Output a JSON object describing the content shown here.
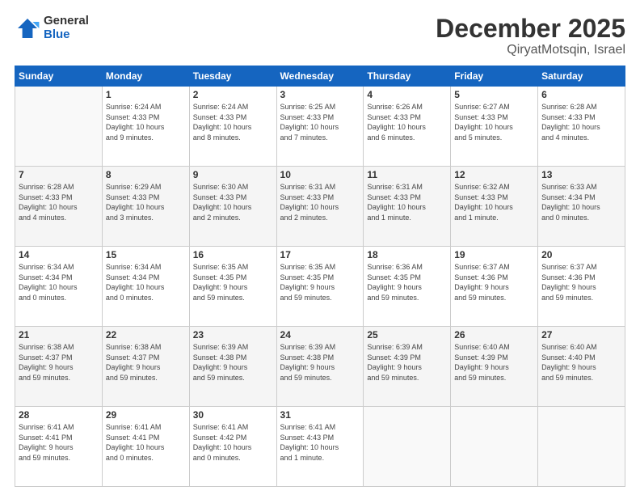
{
  "logo": {
    "general": "General",
    "blue": "Blue"
  },
  "header": {
    "month": "December 2025",
    "location": "QiryatMotsqin, Israel"
  },
  "weekdays": [
    "Sunday",
    "Monday",
    "Tuesday",
    "Wednesday",
    "Thursday",
    "Friday",
    "Saturday"
  ],
  "weeks": [
    [
      {
        "day": "",
        "info": ""
      },
      {
        "day": "1",
        "info": "Sunrise: 6:24 AM\nSunset: 4:33 PM\nDaylight: 10 hours\nand 9 minutes."
      },
      {
        "day": "2",
        "info": "Sunrise: 6:24 AM\nSunset: 4:33 PM\nDaylight: 10 hours\nand 8 minutes."
      },
      {
        "day": "3",
        "info": "Sunrise: 6:25 AM\nSunset: 4:33 PM\nDaylight: 10 hours\nand 7 minutes."
      },
      {
        "day": "4",
        "info": "Sunrise: 6:26 AM\nSunset: 4:33 PM\nDaylight: 10 hours\nand 6 minutes."
      },
      {
        "day": "5",
        "info": "Sunrise: 6:27 AM\nSunset: 4:33 PM\nDaylight: 10 hours\nand 5 minutes."
      },
      {
        "day": "6",
        "info": "Sunrise: 6:28 AM\nSunset: 4:33 PM\nDaylight: 10 hours\nand 4 minutes."
      }
    ],
    [
      {
        "day": "7",
        "info": "Sunrise: 6:28 AM\nSunset: 4:33 PM\nDaylight: 10 hours\nand 4 minutes."
      },
      {
        "day": "8",
        "info": "Sunrise: 6:29 AM\nSunset: 4:33 PM\nDaylight: 10 hours\nand 3 minutes."
      },
      {
        "day": "9",
        "info": "Sunrise: 6:30 AM\nSunset: 4:33 PM\nDaylight: 10 hours\nand 2 minutes."
      },
      {
        "day": "10",
        "info": "Sunrise: 6:31 AM\nSunset: 4:33 PM\nDaylight: 10 hours\nand 2 minutes."
      },
      {
        "day": "11",
        "info": "Sunrise: 6:31 AM\nSunset: 4:33 PM\nDaylight: 10 hours\nand 1 minute."
      },
      {
        "day": "12",
        "info": "Sunrise: 6:32 AM\nSunset: 4:33 PM\nDaylight: 10 hours\nand 1 minute."
      },
      {
        "day": "13",
        "info": "Sunrise: 6:33 AM\nSunset: 4:34 PM\nDaylight: 10 hours\nand 0 minutes."
      }
    ],
    [
      {
        "day": "14",
        "info": "Sunrise: 6:34 AM\nSunset: 4:34 PM\nDaylight: 10 hours\nand 0 minutes."
      },
      {
        "day": "15",
        "info": "Sunrise: 6:34 AM\nSunset: 4:34 PM\nDaylight: 10 hours\nand 0 minutes."
      },
      {
        "day": "16",
        "info": "Sunrise: 6:35 AM\nSunset: 4:35 PM\nDaylight: 9 hours\nand 59 minutes."
      },
      {
        "day": "17",
        "info": "Sunrise: 6:35 AM\nSunset: 4:35 PM\nDaylight: 9 hours\nand 59 minutes."
      },
      {
        "day": "18",
        "info": "Sunrise: 6:36 AM\nSunset: 4:35 PM\nDaylight: 9 hours\nand 59 minutes."
      },
      {
        "day": "19",
        "info": "Sunrise: 6:37 AM\nSunset: 4:36 PM\nDaylight: 9 hours\nand 59 minutes."
      },
      {
        "day": "20",
        "info": "Sunrise: 6:37 AM\nSunset: 4:36 PM\nDaylight: 9 hours\nand 59 minutes."
      }
    ],
    [
      {
        "day": "21",
        "info": "Sunrise: 6:38 AM\nSunset: 4:37 PM\nDaylight: 9 hours\nand 59 minutes."
      },
      {
        "day": "22",
        "info": "Sunrise: 6:38 AM\nSunset: 4:37 PM\nDaylight: 9 hours\nand 59 minutes."
      },
      {
        "day": "23",
        "info": "Sunrise: 6:39 AM\nSunset: 4:38 PM\nDaylight: 9 hours\nand 59 minutes."
      },
      {
        "day": "24",
        "info": "Sunrise: 6:39 AM\nSunset: 4:38 PM\nDaylight: 9 hours\nand 59 minutes."
      },
      {
        "day": "25",
        "info": "Sunrise: 6:39 AM\nSunset: 4:39 PM\nDaylight: 9 hours\nand 59 minutes."
      },
      {
        "day": "26",
        "info": "Sunrise: 6:40 AM\nSunset: 4:39 PM\nDaylight: 9 hours\nand 59 minutes."
      },
      {
        "day": "27",
        "info": "Sunrise: 6:40 AM\nSunset: 4:40 PM\nDaylight: 9 hours\nand 59 minutes."
      }
    ],
    [
      {
        "day": "28",
        "info": "Sunrise: 6:41 AM\nSunset: 4:41 PM\nDaylight: 9 hours\nand 59 minutes."
      },
      {
        "day": "29",
        "info": "Sunrise: 6:41 AM\nSunset: 4:41 PM\nDaylight: 10 hours\nand 0 minutes."
      },
      {
        "day": "30",
        "info": "Sunrise: 6:41 AM\nSunset: 4:42 PM\nDaylight: 10 hours\nand 0 minutes."
      },
      {
        "day": "31",
        "info": "Sunrise: 6:41 AM\nSunset: 4:43 PM\nDaylight: 10 hours\nand 1 minute."
      },
      {
        "day": "",
        "info": ""
      },
      {
        "day": "",
        "info": ""
      },
      {
        "day": "",
        "info": ""
      }
    ]
  ]
}
